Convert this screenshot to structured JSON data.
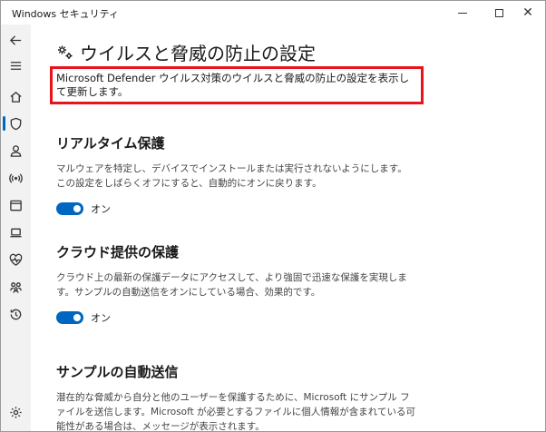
{
  "window": {
    "title": "Windows セキュリティ",
    "controls": {
      "minimize": "–",
      "maximize": "□",
      "close": "✕"
    }
  },
  "sidebar": {
    "items": [
      {
        "icon": "back-arrow-icon"
      },
      {
        "icon": "hamburger-menu-icon"
      },
      {
        "icon": "home-icon"
      },
      {
        "icon": "shield-icon",
        "active": true
      },
      {
        "icon": "account-icon"
      },
      {
        "icon": "wifi-antenna-icon"
      },
      {
        "icon": "app-browser-icon"
      },
      {
        "icon": "laptop-icon"
      },
      {
        "icon": "heart-health-icon"
      },
      {
        "icon": "family-icon"
      },
      {
        "icon": "history-icon"
      },
      {
        "icon": "settings-gear-icon"
      }
    ]
  },
  "page": {
    "title": "ウイルスと脅威の防止の設定",
    "description": "Microsoft Defender ウイルス対策のウイルスと脅威の防止の設定を表示して更新します。"
  },
  "sections": [
    {
      "title": "リアルタイム保護",
      "description": "マルウェアを特定し、デバイスでインストールまたは実行されないようにします。この設定をしばらくオフにすると、自動的にオンに戻ります。",
      "toggle_label": "オン",
      "toggle_on": true
    },
    {
      "title": "クラウド提供の保護",
      "description": "クラウド上の最新の保護データにアクセスして、より強固で迅速な保護を実現します。サンプルの自動送信をオンにしている場合、効果的です。",
      "toggle_label": "オン",
      "toggle_on": true
    },
    {
      "title": "サンプルの自動送信",
      "description": "潜在的な脅威から自分と他のユーザーを保護するために、Microsoft にサンプル ファイルを送信します。Microsoft が必要とするファイルに個人情報が含まれている可能性がある場合は、メッセージが表示されます。"
    }
  ],
  "colors": {
    "accent": "#0067c0",
    "highlight_border": "#e8141c",
    "sidebar_bg": "#f2f2f2"
  }
}
